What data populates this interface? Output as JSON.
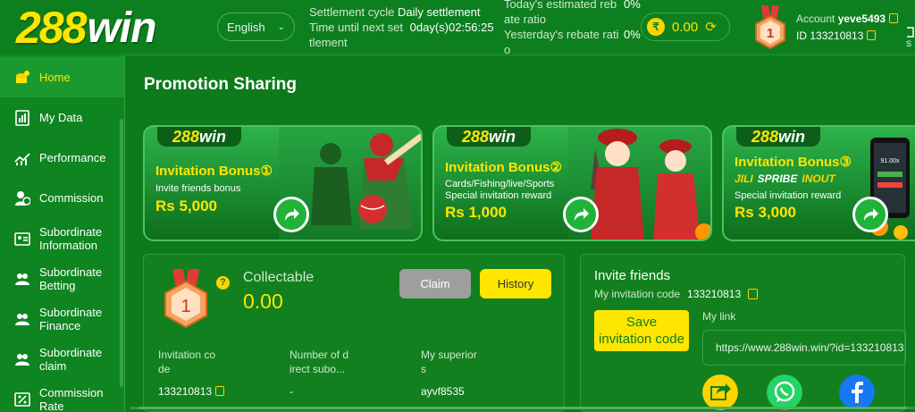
{
  "header": {
    "logo_number": "288",
    "logo_word": "win",
    "language": "English",
    "settlement_cycle_label": "Settlement cycle",
    "settlement_cycle_value": "Daily settlement",
    "time_until_label_1": "Time until next set",
    "time_until_label_2": "tlement",
    "time_until_value": "0day(s)02:56:25",
    "today_rebate_label_1": "Today's estimated reb",
    "today_rebate_label_2": "ate ratio",
    "today_rebate_value": "0%",
    "yesterday_rebate_label_1": "Yesterday's rebate rati",
    "yesterday_rebate_label_2": "o",
    "yesterday_rebate_value": "0%",
    "balance": "0.00",
    "account_label": "Account",
    "account_name": "yeve5493",
    "id_label": "ID",
    "id_value": "133210813",
    "far_right_text": "S"
  },
  "sidebar": {
    "items": [
      {
        "label": "Home",
        "icon": "home-icon"
      },
      {
        "label": "My Data",
        "icon": "data-icon"
      },
      {
        "label": "Performance",
        "icon": "performance-icon"
      },
      {
        "label": "Commission",
        "icon": "commission-icon"
      },
      {
        "label": "Subordinate Information",
        "icon": "subordinate-info-icon"
      },
      {
        "label": "Subordinate Betting",
        "icon": "subordinate-betting-icon"
      },
      {
        "label": "Subordinate Finance",
        "icon": "subordinate-finance-icon"
      },
      {
        "label": "Subordinate claim",
        "icon": "subordinate-claim-icon"
      },
      {
        "label": "Commission Rate",
        "icon": "commission-rate-icon"
      }
    ]
  },
  "main": {
    "title": "Promotion Sharing",
    "banners": [
      {
        "logo_number": "288",
        "logo_word": "win",
        "title": "Invitation Bonus",
        "badge": "①",
        "subtitle": "Invite friends bonus",
        "amount": "Rs 5,000"
      },
      {
        "logo_number": "288",
        "logo_word": "win",
        "title": "Invitation Bonus",
        "badge": "②",
        "subtitle_1": "Cards/Fishing/live/Sports",
        "subtitle_2": "Special invitation reward",
        "amount": "Rs 1,000"
      },
      {
        "logo_number": "288",
        "logo_word": "win",
        "title": "Invitation Bonus",
        "badge": "③",
        "brands": [
          "JILI",
          "SPRIBE",
          "INOUT"
        ],
        "subtitle": "Special invitation reward",
        "amount": "Rs 3,000",
        "phone_text": "91.00x"
      }
    ],
    "collect": {
      "medal_number": "1",
      "help": "?",
      "collectable_label": "Collectable",
      "collectable_value": "0.00",
      "claim_label": "Claim",
      "history_label": "History",
      "columns": [
        {
          "header_1": "Invitation co",
          "header_2": "de",
          "value": "133210813"
        },
        {
          "header_1": "Number of d",
          "header_2": "irect subo...",
          "value": "-"
        },
        {
          "header_1": "My superior",
          "header_2": "s",
          "value": "ayvf8535"
        }
      ]
    },
    "invite": {
      "title": "Invite friends",
      "code_label": "My invitation code",
      "code_value": "133210813",
      "save_label_1": "Save",
      "save_label_2": "invitation code",
      "link_label": "My link",
      "link_value": "https://www.288win.win/?id=133210813"
    }
  },
  "colors": {
    "accent": "#ffe600",
    "background": "#0d7a1c",
    "panel": "#12801e"
  }
}
